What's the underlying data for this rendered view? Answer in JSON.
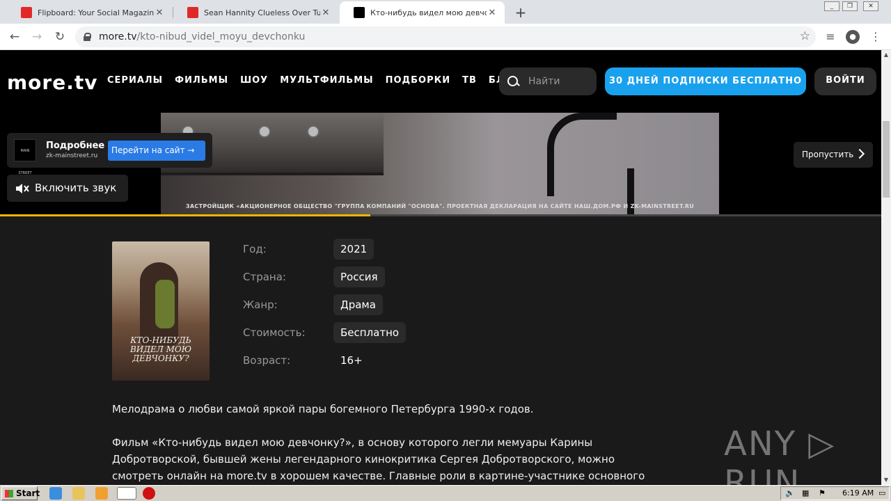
{
  "browser": {
    "tabs": [
      {
        "title": "Flipboard: Your Social Magazine",
        "favicon": "flipboard-icon",
        "color": "#e12828",
        "active": false
      },
      {
        "title": "Sean Hannity Clueless Over Tucker C",
        "favicon": "flipboard-icon",
        "color": "#e12828",
        "active": false
      },
      {
        "title": "Кто-нибудь видел мою девчонку?",
        "favicon": "moretv-icon",
        "color": "#000000",
        "active": true
      }
    ],
    "close_glyph": "✕",
    "new_tab_glyph": "+",
    "url_host": "more.tv",
    "url_path": "/kto-nibud_videl_moyu_devchonku"
  },
  "site": {
    "logo": "more.tv",
    "nav": [
      "СЕРИАЛЫ",
      "ФИЛЬМЫ",
      "ШОУ",
      "МУЛЬТФИЛЬМЫ",
      "ПОДБОРКИ",
      "ТВ",
      "БЛОГ"
    ],
    "search_placeholder": "Найти",
    "subscribe_label": "30 ДНЕЙ ПОДПИСКИ БЕСПЛАТНО",
    "login_label": "ВОЙТИ"
  },
  "ad": {
    "logo_text": "MAIN STREET",
    "more_label": "Подробнее",
    "domain": "zk-mainstreet.ru",
    "go_site_label": "Перейти на сайт →",
    "sound_label": "Включить звук",
    "skip_label": "Пропустить",
    "caption": "ЗАСТРОЙЩИК «АКЦИОНЕРНОЕ ОБЩЕСТВО \"ГРУППА КОМПАНИЙ \"ОСНОВА\". ПРОЕКТНАЯ ДЕКЛАРАЦИЯ НА САЙТЕ НАШ.ДОМ.РФ И ZK-MAINSTREET.RU",
    "progress_fraction": 0.42,
    "progress_color": "#f5b400"
  },
  "movie": {
    "poster_title": "КТО-НИБУДЬ ВИДЕЛ МОЮ ДЕВЧОНКУ?",
    "meta": [
      {
        "label": "Год:",
        "value": "2021"
      },
      {
        "label": "Страна:",
        "value": "Россия"
      },
      {
        "label": "Жанр:",
        "value": "Драма"
      },
      {
        "label": "Стоимость:",
        "value": "Бесплатно"
      },
      {
        "label": "Возраст:",
        "value": "16+"
      }
    ],
    "description": [
      "Мелодрама о любви самой яркой пары богемного Петербурга 1990-х годов.",
      "Фильм «Кто-нибудь видел мою девчонку?», в основу которого легли мемуары Карины Добротворской, бывшей жены легендарного кинокритика Сергея Добротворского, можно смотреть онлайн на more.tv в хорошем качестве. Главные роли в картине-участнике основного"
    ]
  },
  "watermark": "ANY ▷ RUN",
  "taskbar": {
    "start_label": "Start",
    "time": "6:19 AM"
  }
}
